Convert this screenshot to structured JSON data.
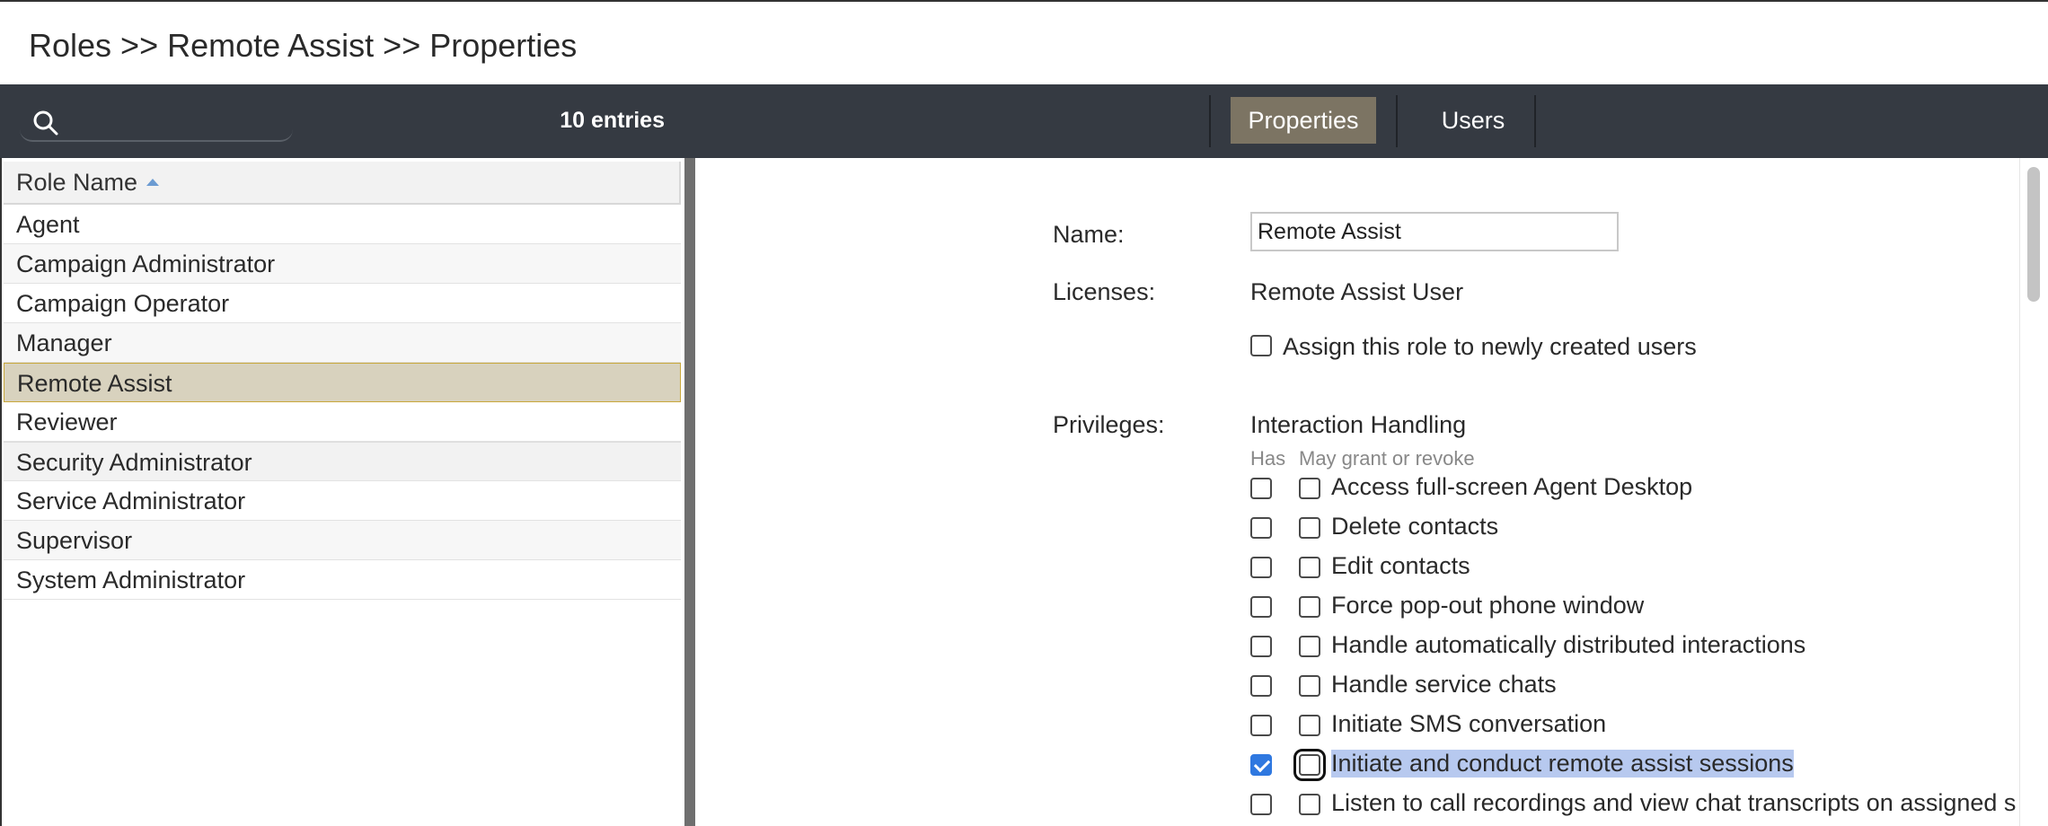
{
  "breadcrumb": "Roles >> Remote Assist >> Properties",
  "search": {
    "placeholder": "",
    "value": ""
  },
  "entries_count": "10 entries",
  "tabs": [
    {
      "label": "Properties",
      "active": true
    },
    {
      "label": "Users",
      "active": false
    }
  ],
  "role_list": {
    "column_header": "Role Name",
    "sort": "ascending",
    "items": [
      {
        "label": "Agent"
      },
      {
        "label": "Campaign Administrator"
      },
      {
        "label": "Campaign Operator"
      },
      {
        "label": "Manager"
      },
      {
        "label": "Remote Assist",
        "selected": true
      },
      {
        "label": "Reviewer"
      },
      {
        "label": "Security Administrator"
      },
      {
        "label": "Service Administrator"
      },
      {
        "label": "Supervisor"
      },
      {
        "label": "System Administrator"
      }
    ]
  },
  "properties": {
    "name_label": "Name:",
    "name_value": "Remote Assist",
    "licenses_label": "Licenses:",
    "licenses_value": "Remote Assist User",
    "assign_label": "Assign this role to newly created users",
    "assign_checked": false,
    "privileges_label": "Privileges:",
    "privileges_group": "Interaction Handling",
    "col_has": "Has",
    "col_grant": "May grant or revoke",
    "privileges": [
      {
        "label": "Access full-screen Agent Desktop",
        "has": false,
        "grant": false
      },
      {
        "label": "Delete contacts",
        "has": false,
        "grant": false
      },
      {
        "label": "Edit contacts",
        "has": false,
        "grant": false
      },
      {
        "label": "Force pop-out phone window",
        "has": false,
        "grant": false
      },
      {
        "label": "Handle automatically distributed interactions",
        "has": false,
        "grant": false
      },
      {
        "label": "Handle service chats",
        "has": false,
        "grant": false
      },
      {
        "label": "Initiate SMS conversation",
        "has": false,
        "grant": false
      },
      {
        "label": "Initiate and conduct remote assist sessions",
        "has": true,
        "grant": false,
        "focused": true
      },
      {
        "label": "Listen to call recordings and view chat transcripts on assigned s",
        "has": false,
        "grant": false
      }
    ]
  },
  "colors": {
    "toolbar_bg": "#353a42",
    "tab_active_bg": "#7c7463",
    "selected_row_bg": "#d8d2be",
    "checkbox_checked": "#2f78e0",
    "highlight_bg": "#b7c9ef"
  }
}
